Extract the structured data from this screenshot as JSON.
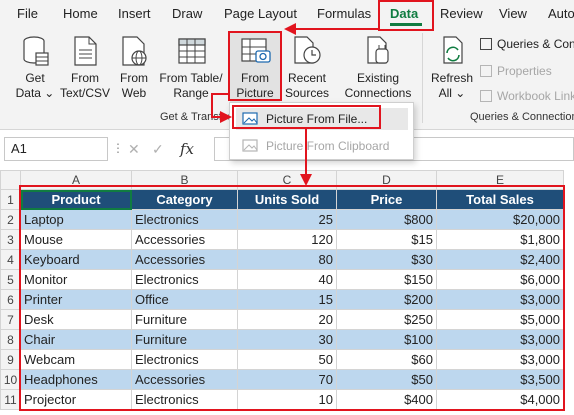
{
  "menu": {
    "tabs": [
      "File",
      "Home",
      "Insert",
      "Draw",
      "Page Layout",
      "Formulas",
      "Data",
      "Review",
      "View",
      "Automate"
    ]
  },
  "ribbon": {
    "get_data": [
      "Get",
      "Data ⌄"
    ],
    "from_text_csv": [
      "From",
      "Text/CSV"
    ],
    "from_web": [
      "From",
      "Web"
    ],
    "from_table_range": [
      "From Table/",
      "Range"
    ],
    "from_picture": [
      "From",
      "Picture ⌄"
    ],
    "recent_sources": [
      "Recent",
      "Sources"
    ],
    "existing_connections": [
      "Existing",
      "Connections"
    ],
    "refresh_all": [
      "Refresh",
      "All ⌄"
    ],
    "group_get_transform": "Get & Transform Data",
    "group_queries": "Queries & Connections",
    "queries_connections": "Queries & Connections",
    "properties": "Properties",
    "workbook_links": "Workbook Links"
  },
  "dropdown": {
    "picture_from_file": "Picture From File...",
    "picture_from_clipboard": "Picture From Clipboard"
  },
  "formula_bar": {
    "name_box": "A1",
    "fx": "fx",
    "cancel": "✕",
    "enter": "✓"
  },
  "sheet": {
    "columns": [
      "A",
      "B",
      "C",
      "D",
      "E"
    ],
    "row_numbers": [
      "1",
      "2",
      "3",
      "4",
      "5",
      "6",
      "7",
      "8",
      "9",
      "10",
      "11"
    ],
    "headers": [
      "Product",
      "Category",
      "Units Sold",
      "Price",
      "Total Sales"
    ],
    "rows": [
      [
        "Laptop",
        "Electronics",
        "25",
        "$800",
        "$20,000"
      ],
      [
        "Mouse",
        "Accessories",
        "120",
        "$15",
        "$1,800"
      ],
      [
        "Keyboard",
        "Accessories",
        "80",
        "$30",
        "$2,400"
      ],
      [
        "Monitor",
        "Electronics",
        "40",
        "$150",
        "$6,000"
      ],
      [
        "Printer",
        "Office",
        "15",
        "$200",
        "$3,000"
      ],
      [
        "Desk",
        "Furniture",
        "20",
        "$250",
        "$5,000"
      ],
      [
        "Chair",
        "Furniture",
        "30",
        "$100",
        "$3,000"
      ],
      [
        "Webcam",
        "Electronics",
        "50",
        "$60",
        "$3,000"
      ],
      [
        "Headphones",
        "Accessories",
        "70",
        "$50",
        "$3,500"
      ],
      [
        "Projector",
        "Electronics",
        "10",
        "$400",
        "$4,000"
      ]
    ]
  },
  "colors": {
    "accent": "#107c41",
    "header_fill": "#1f4e79",
    "band_fill": "#bdd7ee",
    "annotation": "#e1141e"
  }
}
